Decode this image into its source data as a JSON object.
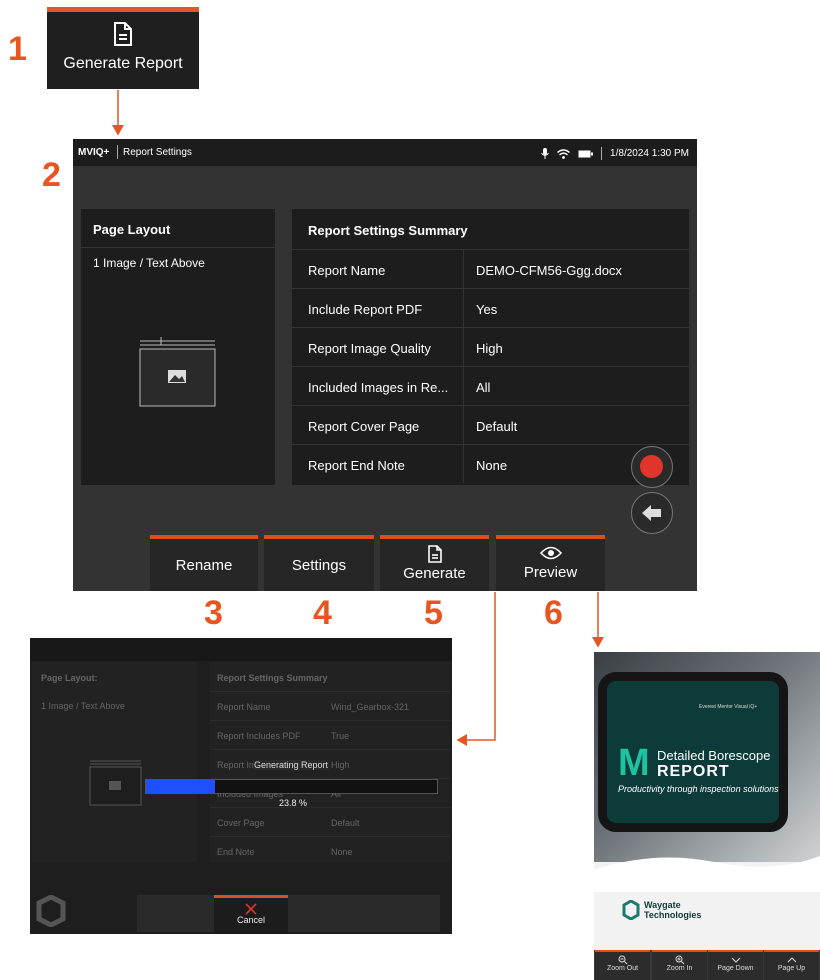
{
  "callouts": {
    "c1": "1",
    "c2": "2",
    "c3": "3",
    "c4": "4",
    "c5": "5",
    "c6": "6"
  },
  "step1": {
    "label": "Generate Report",
    "icon": "document-icon"
  },
  "status_bar": {
    "brand": "MVIQ+",
    "title": "Report Settings",
    "datetime": "1/8/2024 1:30 PM"
  },
  "layout_panel": {
    "title": "Page Layout",
    "option": "1 Image / Text Above"
  },
  "summary": {
    "title": "Report Settings Summary",
    "rows": [
      {
        "key": "Report Name",
        "value": "DEMO-CFM56-Ggg.docx"
      },
      {
        "key": "Include Report PDF",
        "value": "Yes"
      },
      {
        "key": "Report Image Quality",
        "value": "High"
      },
      {
        "key": "Included Images in Re...",
        "value": "All"
      },
      {
        "key": "Report Cover Page",
        "value": "Default"
      },
      {
        "key": "Report End Note",
        "value": "None"
      }
    ]
  },
  "softkeys": {
    "rename": "Rename",
    "settings": "Settings",
    "generate": "Generate",
    "preview": "Preview"
  },
  "progress_screen": {
    "layout_title": "Page Layout:",
    "layout_option": "1 Image / Text Above",
    "summary_title": "Report Settings Summary",
    "rows": [
      {
        "key": "Report Name",
        "value": "Wind_Gearbox-321"
      },
      {
        "key": "Report Includes PDF",
        "value": "True"
      },
      {
        "key": "Report Image Quality",
        "value": "High"
      },
      {
        "key": "Included Images",
        "value": "All"
      },
      {
        "key": "Cover Page",
        "value": "Default"
      },
      {
        "key": "End Note",
        "value": "None"
      }
    ],
    "progress_label": "Generating Report",
    "progress_text": "23.8 %",
    "progress_fraction": 0.238,
    "cancel": "Cancel"
  },
  "preview": {
    "device_text": "Everest Mentor Visual iQ+",
    "heading_line1": "Detailed Borescope",
    "heading_line2": "REPORT",
    "tagline": "Productivity through inspection solutions",
    "logo_line1": "Waygate",
    "logo_line2": "Technologies",
    "toolbar": [
      "Zoom Out",
      "Zoom In",
      "Page Down",
      "Page Up"
    ]
  },
  "colors": {
    "accent": "#e0552a",
    "callout": "#e8551f",
    "progress": "#1f4fff",
    "record": "#e0352a"
  }
}
